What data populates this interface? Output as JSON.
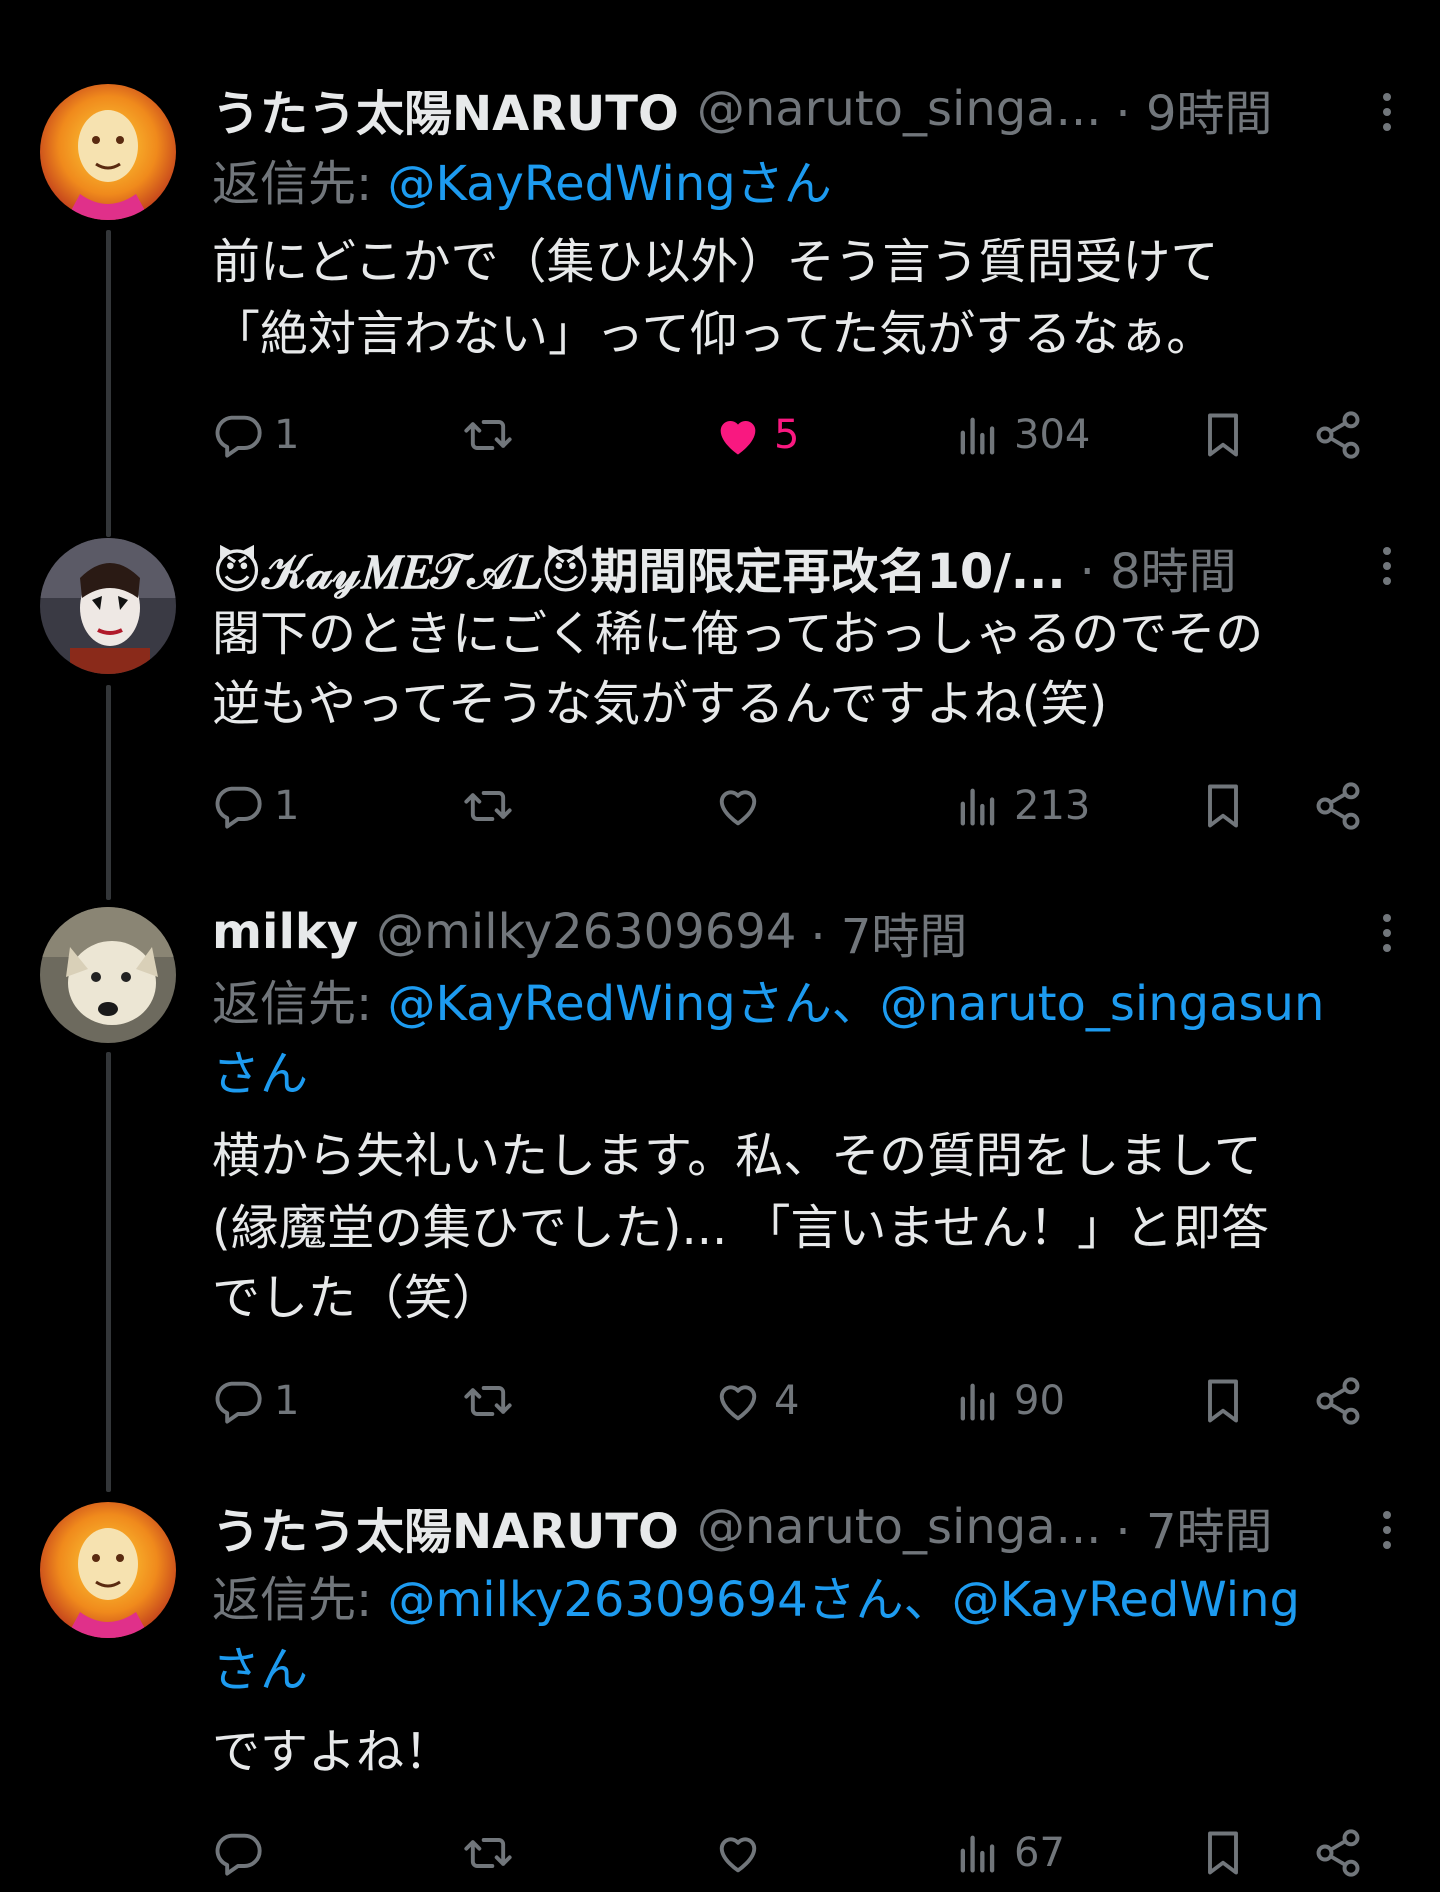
{
  "tweets": [
    {
      "name": "うたう太陽NARUTO",
      "handle": "@naruto_singa...",
      "time": "· 9時間",
      "reply_prefix": "返信先: ",
      "reply_to": "@KayRedWingさん",
      "reply_to_2": "",
      "body": [
        "前にどこかで（集ひ以外）そう言う質問受けて",
        "「絶対言わない」って仰ってた気がするなぁ。"
      ],
      "replies": "1",
      "retweets": "",
      "likes": "5",
      "views": "304",
      "liked": true
    },
    {
      "name": "😈𝒦𝒶𝓎𝑀𝐸𝒯𝒜𝐿😈期間限定再改名10/...",
      "handle": "",
      "time": "· 8時間",
      "reply_prefix": "",
      "reply_to": "",
      "body": [
        "閣下のときにごく稀に俺っておっしゃるのでその",
        "逆もやってそうな気がするんですよね(笑)"
      ],
      "replies": "1",
      "retweets": "",
      "likes": "",
      "views": "213",
      "liked": false
    },
    {
      "name": "milky",
      "handle": "@milky26309694",
      "time": "· 7時間",
      "reply_prefix": "返信先: ",
      "reply_to": "@KayRedWingさん、@naruto_singasun",
      "reply_to_2": "さん",
      "body": [
        "横から失礼いたします。私、その質問をしまして",
        "(縁魔堂の集ひでした)... 「言いません！」と即答",
        "でした（笑）"
      ],
      "replies": "1",
      "retweets": "",
      "likes": "4",
      "views": "90",
      "liked": false
    },
    {
      "name": "うたう太陽NARUTO",
      "handle": "@naruto_singa...",
      "time": "· 7時間",
      "reply_prefix": "返信先: ",
      "reply_to": "@milky26309694さん、@KayRedWing",
      "reply_to_2": "さん",
      "body": [
        "ですよね！"
      ],
      "replies": "",
      "retweets": "",
      "likes": "",
      "views": "67",
      "liked": false
    }
  ],
  "icons": {
    "reply": "reply-icon",
    "retweet": "retweet-icon",
    "like": "heart-icon",
    "views": "views-icon",
    "bookmark": "bookmark-icon",
    "share": "share-icon",
    "more": "more-icon"
  },
  "colors": {
    "background": "#000000",
    "text": "#e7e9ea",
    "muted": "#71767b",
    "mention": "#1d9bf0",
    "like": "#f91880"
  }
}
